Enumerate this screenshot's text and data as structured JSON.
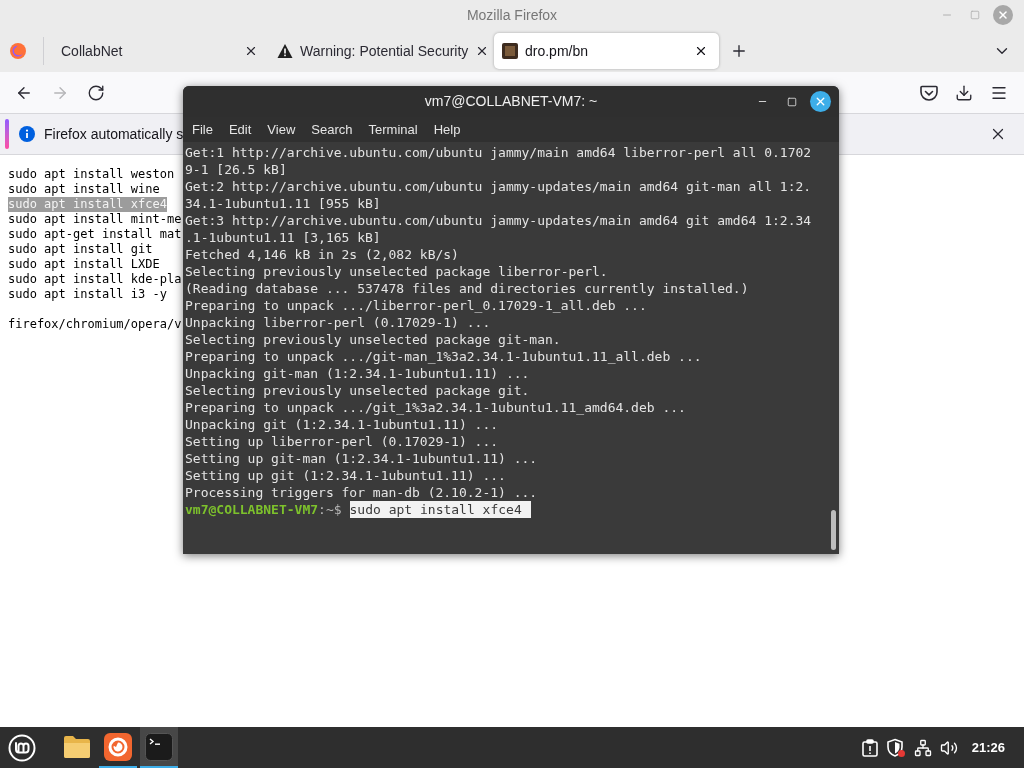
{
  "window": {
    "title": "Mozilla Firefox"
  },
  "tabs": [
    {
      "label": "CollabNet",
      "selected": false,
      "kind": "plain"
    },
    {
      "label": "Warning: Potential Security",
      "selected": false,
      "kind": "warning"
    },
    {
      "label": "dro.pm/bn",
      "selected": true,
      "kind": "favicon"
    }
  ],
  "nav_buttons": [
    {
      "kind": "back",
      "disabled": false
    },
    {
      "kind": "forward",
      "disabled": true
    },
    {
      "kind": "reload",
      "disabled": false
    }
  ],
  "notification": {
    "text": "Firefox automatically s"
  },
  "page": {
    "blocks": [
      {
        "lines": [
          {
            "text": "sudo apt install weston",
            "selected": false
          },
          {
            "text": "sudo apt install wine",
            "selected": false
          },
          {
            "text": "sudo apt install xfce4",
            "selected": true
          },
          {
            "text": "sudo apt install mint-me",
            "selected": false
          },
          {
            "text": "sudo apt-get install mat",
            "selected": false
          },
          {
            "text": "sudo apt install git",
            "selected": false
          },
          {
            "text": "sudo apt install LXDE",
            "selected": false
          },
          {
            "text": "sudo apt install kde-pla",
            "selected": false
          },
          {
            "text": "sudo apt install i3 -y",
            "selected": false
          }
        ]
      },
      {
        "lines": [
          {
            "text": "firefox/chromium/opera/v",
            "selected": false
          }
        ]
      }
    ]
  },
  "terminal": {
    "title": "vm7@COLLABNET-VM7: ~",
    "menu": [
      "File",
      "Edit",
      "View",
      "Search",
      "Terminal",
      "Help"
    ],
    "output": [
      "Get:1 http://archive.ubuntu.com/ubuntu jammy/main amd64 liberror-perl all 0.1702",
      "9-1 [26.5 kB]",
      "Get:2 http://archive.ubuntu.com/ubuntu jammy-updates/main amd64 git-man all 1:2.",
      "34.1-1ubuntu1.11 [955 kB]",
      "Get:3 http://archive.ubuntu.com/ubuntu jammy-updates/main amd64 git amd64 1:2.34",
      ".1-1ubuntu1.11 [3,165 kB]",
      "Fetched 4,146 kB in 2s (2,082 kB/s)",
      "Selecting previously unselected package liberror-perl.",
      "(Reading database ... 537478 files and directories currently installed.)",
      "Preparing to unpack .../liberror-perl_0.17029-1_all.deb ...",
      "Unpacking liberror-perl (0.17029-1) ...",
      "Selecting previously unselected package git-man.",
      "Preparing to unpack .../git-man_1%3a2.34.1-1ubuntu1.11_all.deb ...",
      "Unpacking git-man (1:2.34.1-1ubuntu1.11) ...",
      "Selecting previously unselected package git.",
      "Preparing to unpack .../git_1%3a2.34.1-1ubuntu1.11_amd64.deb ...",
      "Unpacking git (1:2.34.1-1ubuntu1.11) ...",
      "Setting up liberror-perl (0.17029-1) ...",
      "Setting up git-man (1:2.34.1-1ubuntu1.11) ...",
      "Setting up git (1:2.34.1-1ubuntu1.11) ...",
      "Processing triggers for man-db (2.10.2-1) ..."
    ],
    "prompt": {
      "user_host": "vm7@COLLABNET-VM7",
      "path": ":~$",
      "command": "sudo apt install xfce4",
      "selected": true
    }
  },
  "taskbar": {
    "apps": [
      {
        "kind": "files",
        "running": false,
        "focused": false
      },
      {
        "kind": "firefox",
        "running": true,
        "focused": false
      },
      {
        "kind": "terminal",
        "running": true,
        "focused": true
      }
    ],
    "clock": "21:26"
  }
}
